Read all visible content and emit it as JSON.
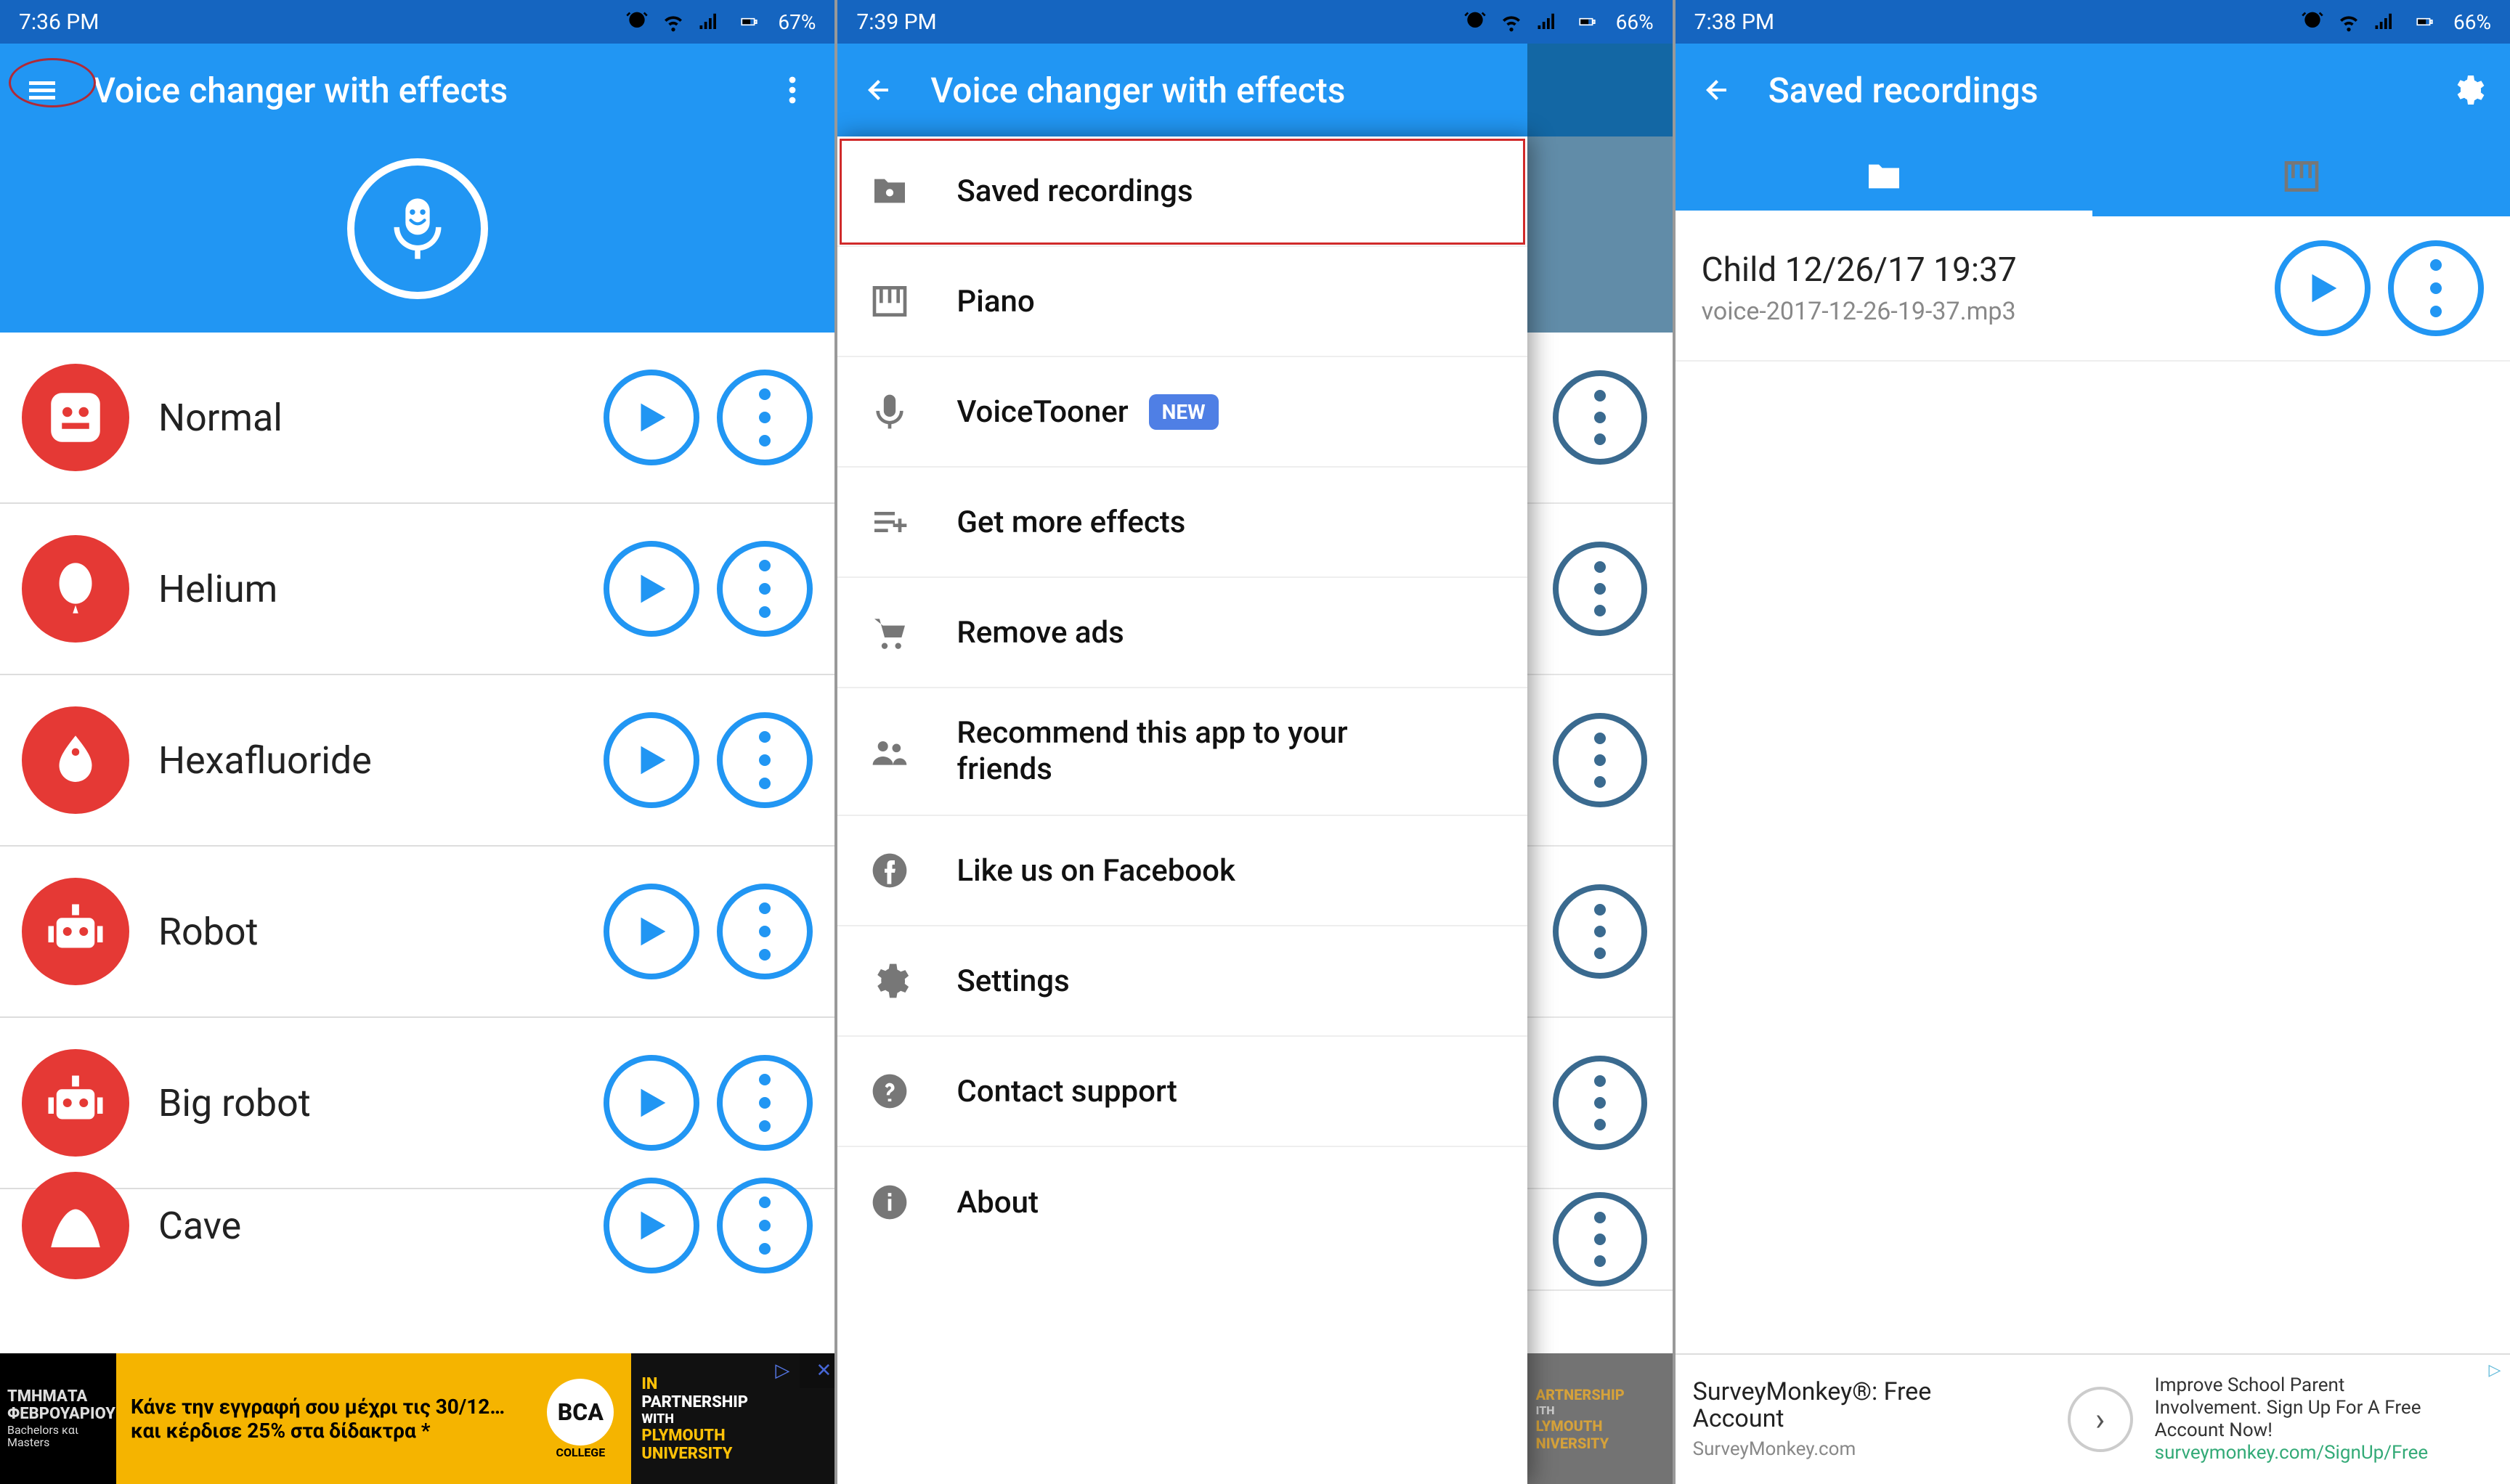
{
  "screen1": {
    "status": {
      "time": "7:36 PM",
      "battery": "67%"
    },
    "appbar": {
      "title": "Voice changer with effects"
    },
    "effects": [
      {
        "label": "Normal",
        "icon": "face"
      },
      {
        "label": "Helium",
        "icon": "balloon"
      },
      {
        "label": "Hexafluoride",
        "icon": "drop"
      },
      {
        "label": "Robot",
        "icon": "robot"
      },
      {
        "label": "Big robot",
        "icon": "robot"
      },
      {
        "label": "Cave",
        "icon": "cave"
      }
    ],
    "ad": {
      "black1": "ΤΜΗΜΑΤΑ",
      "black2": "ΦΕΒΡΟΥΑΡΙΟΥ",
      "black3": "Bachelors και Masters",
      "yellow1": "Κάνε την εγγραφή σου μέχρι τις 30/12…",
      "yellow2": "και κέρδισε 25% στα δίδακτρα *",
      "logo_top": "BCA",
      "logo_bottom": "COLLEGE",
      "tail1": "IN",
      "tail2": "PARTNERSHIP",
      "tail3": "WITH",
      "tail4": "PLYMOUTH",
      "tail5": "UNIVERSITY"
    }
  },
  "screen2": {
    "status": {
      "time": "7:39 PM",
      "battery": "66%"
    },
    "appbar": {
      "title": "Voice changer with effects"
    },
    "drawer": {
      "items": [
        {
          "label": "Saved recordings",
          "icon": "folder-mic",
          "highlight": true
        },
        {
          "label": "Piano",
          "icon": "piano"
        },
        {
          "label": "VoiceTooner",
          "icon": "mic",
          "new": "NEW"
        },
        {
          "label": "Get more effects",
          "icon": "list-add"
        },
        {
          "label": "Remove ads",
          "icon": "cart"
        },
        {
          "label": "Recommend this app to your friends",
          "icon": "people"
        },
        {
          "label": "Like us on Facebook",
          "icon": "facebook"
        },
        {
          "label": "Settings",
          "icon": "gear"
        },
        {
          "label": "Contact support",
          "icon": "help"
        },
        {
          "label": "About",
          "icon": "info"
        }
      ]
    },
    "scrim_ad": {
      "t1": "ARTNERSHIP",
      "t2": "ITH",
      "t3": "LYMOUTH",
      "t4": "NIVERSITY"
    }
  },
  "screen3": {
    "status": {
      "time": "7:38 PM",
      "battery": "66%"
    },
    "appbar": {
      "title": "Saved recordings"
    },
    "recording": {
      "title": "Child 12/26/17 19:37",
      "file": "voice-2017-12-26-19-37.mp3"
    },
    "ad": {
      "title1": "SurveyMonkey®: Free",
      "title2": "Account",
      "domain": "SurveyMonkey.com",
      "body1": "Improve School Parent",
      "body2": "Involvement. Sign Up For A Free",
      "body3": "Account Now!",
      "url": "surveymonkey.com/SignUp/Free"
    }
  }
}
